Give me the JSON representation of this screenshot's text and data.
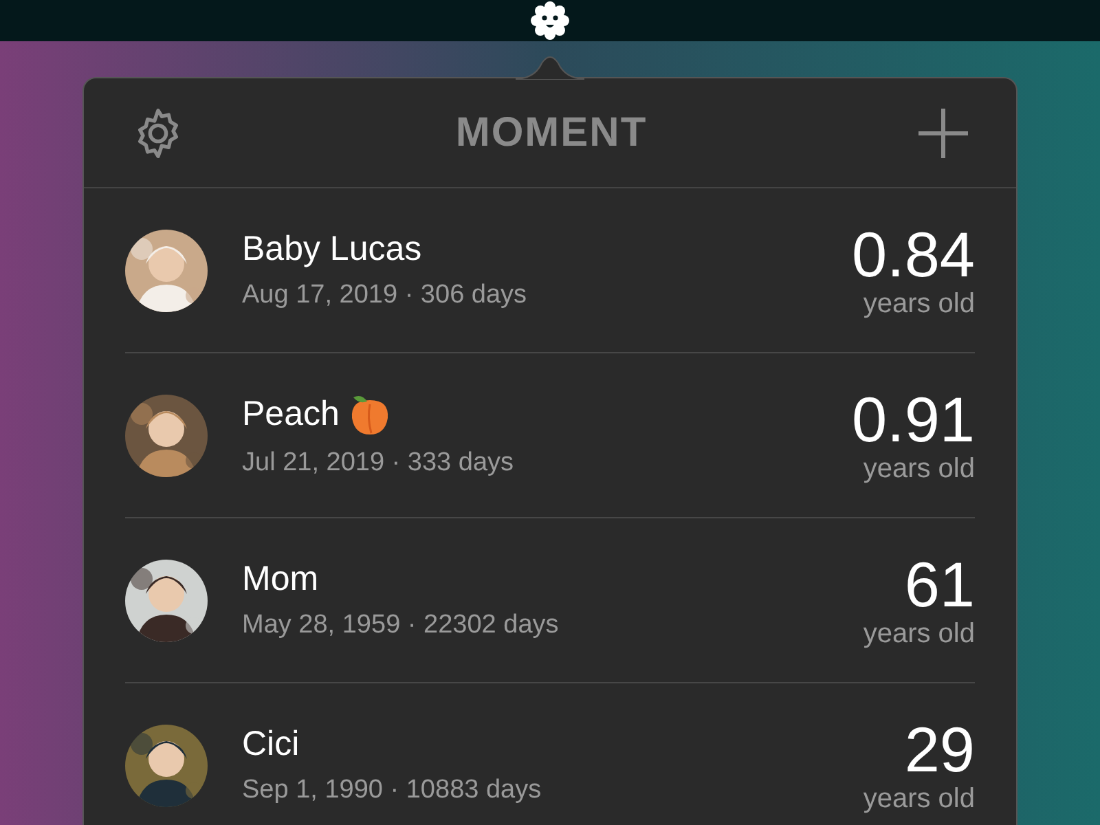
{
  "header": {
    "logo": "MOMENT"
  },
  "people": [
    {
      "name": "Baby Lucas",
      "emoji": false,
      "detail": "Aug 17, 2019 · 306 days",
      "age": "0.84",
      "unit": "years old"
    },
    {
      "name": "Peach",
      "emoji": true,
      "detail": "Jul 21, 2019 · 333 days",
      "age": "0.91",
      "unit": "years old"
    },
    {
      "name": "Mom",
      "emoji": false,
      "detail": "May 28, 1959 · 22302 days",
      "age": "61",
      "unit": "years old"
    },
    {
      "name": "Cici",
      "emoji": false,
      "detail": "Sep 1, 1990 · 10883 days",
      "age": "29",
      "unit": "years old"
    }
  ]
}
